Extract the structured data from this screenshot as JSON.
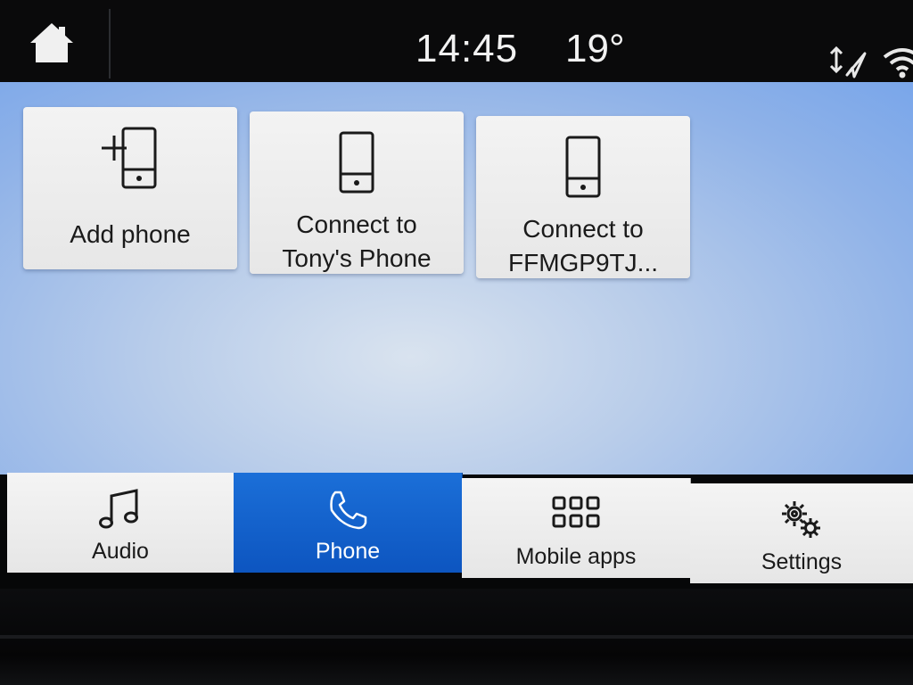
{
  "status_bar": {
    "time": "14:45",
    "temperature": "19°",
    "icons": [
      "home-icon",
      "navigation-arrows-icon",
      "wifi-icon"
    ]
  },
  "main": {
    "tiles": [
      {
        "label": "Add phone",
        "icon": "add-phone-icon"
      },
      {
        "label_line1": "Connect to",
        "label_line2": "Tony's Phone",
        "icon": "phone-icon"
      },
      {
        "label_line1": "Connect to",
        "label_line2": "FFMGP9TJ...",
        "icon": "phone-icon"
      }
    ]
  },
  "tabbar": {
    "tabs": [
      {
        "label": "Audio",
        "icon": "music-note-icon",
        "selected": false
      },
      {
        "label": "Phone",
        "icon": "phone-handset-icon",
        "selected": true
      },
      {
        "label": "Mobile apps",
        "icon": "apps-grid-icon",
        "selected": false
      },
      {
        "label": "Settings",
        "icon": "gears-icon",
        "selected": false
      }
    ]
  },
  "colors": {
    "selected_tab": "#1565d0",
    "background_blue": "#8fb2e8",
    "tile_background": "#eeeeee",
    "bezel": "#0a0a0b"
  }
}
